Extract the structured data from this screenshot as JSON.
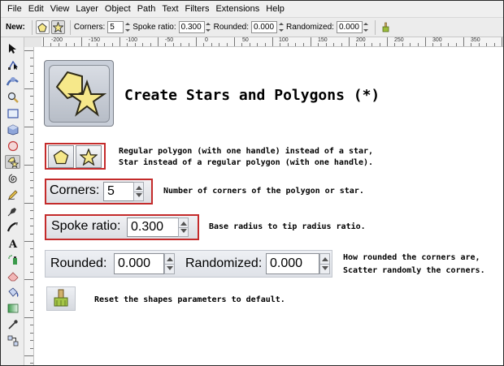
{
  "menubar": {
    "items": [
      "File",
      "Edit",
      "View",
      "Layer",
      "Object",
      "Path",
      "Text",
      "Filters",
      "Extensions",
      "Help"
    ]
  },
  "controls_bar": {
    "new_label": "New:",
    "corners_label": "Corners:",
    "corners_value": "5",
    "spoke_label": "Spoke ratio:",
    "spoke_value": "0.300",
    "rounded_label": "Rounded:",
    "rounded_value": "0.000",
    "randomized_label": "Randomized:",
    "randomized_value": "0.000"
  },
  "ruler": {
    "labels": [
      "-200",
      "-150",
      "-100",
      "-50",
      "0",
      "50",
      "100",
      "150",
      "200",
      "250",
      "300",
      "350"
    ]
  },
  "toolbox": {
    "tools": [
      "selector-icon",
      "node-icon",
      "tweak-icon",
      "zoom-icon",
      "rectangle-icon",
      "box3d-icon",
      "ellipse-icon",
      "star-icon",
      "spiral-icon",
      "pencil-icon",
      "pen-icon",
      "calligraphy-icon",
      "text-icon",
      "spray-icon",
      "eraser-icon",
      "paint-bucket-icon",
      "gradient-icon",
      "dropper-icon",
      "connector-icon"
    ],
    "active_tool": "star-icon"
  },
  "content": {
    "title": "Create Stars and Polygons (*)",
    "shapes_desc_line1": "Regular polygon (with one handle) instead of a star,",
    "shapes_desc_line2": "Star instead of a regular polygon (with one handle).",
    "corners_label": "Corners:",
    "corners_value": "5",
    "corners_desc": "Number of corners of the polygon or star.",
    "spoke_label": "Spoke ratio:",
    "spoke_value": "0.300",
    "spoke_desc": "Base radius to tip radius ratio.",
    "rounded_label": "Rounded:",
    "rounded_value": "0.000",
    "randomized_label": "Randomized:",
    "randomized_value": "0.000",
    "rounded_desc_line1": "How rounded the corners are,",
    "rounded_desc_line2": "Scatter randomly the corners.",
    "reset_desc": "Reset the shapes parameters to default."
  },
  "colors": {
    "highlight_border": "#c42b2b",
    "shape_fill": "#f6e88a",
    "shape_stroke": "#3a3a2a"
  }
}
